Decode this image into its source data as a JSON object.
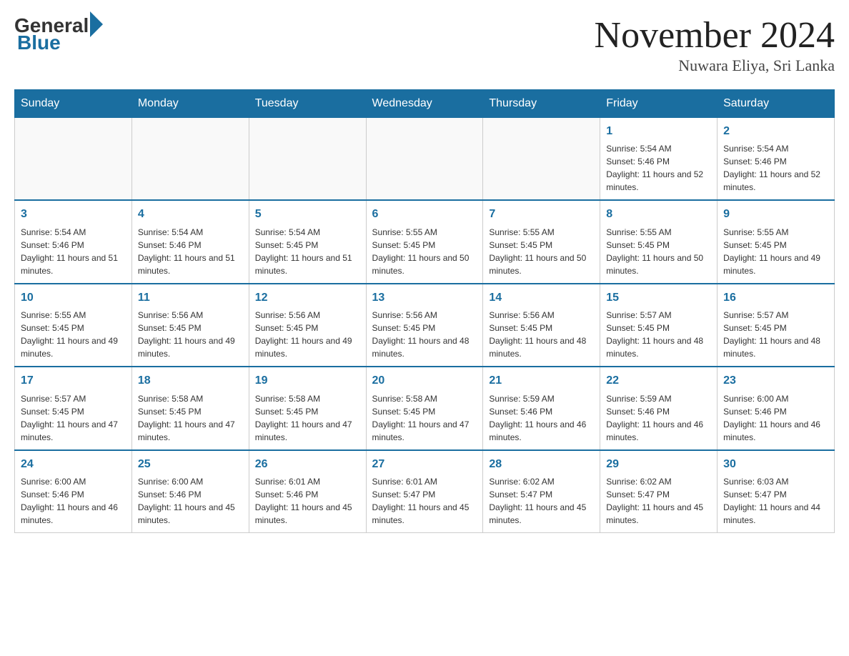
{
  "header": {
    "logo_general": "General",
    "logo_blue": "Blue",
    "month_year": "November 2024",
    "location": "Nuwara Eliya, Sri Lanka"
  },
  "days_of_week": [
    "Sunday",
    "Monday",
    "Tuesday",
    "Wednesday",
    "Thursday",
    "Friday",
    "Saturday"
  ],
  "weeks": [
    {
      "days": [
        {
          "number": "",
          "info": ""
        },
        {
          "number": "",
          "info": ""
        },
        {
          "number": "",
          "info": ""
        },
        {
          "number": "",
          "info": ""
        },
        {
          "number": "",
          "info": ""
        },
        {
          "number": "1",
          "info": "Sunrise: 5:54 AM\nSunset: 5:46 PM\nDaylight: 11 hours and 52 minutes."
        },
        {
          "number": "2",
          "info": "Sunrise: 5:54 AM\nSunset: 5:46 PM\nDaylight: 11 hours and 52 minutes."
        }
      ]
    },
    {
      "days": [
        {
          "number": "3",
          "info": "Sunrise: 5:54 AM\nSunset: 5:46 PM\nDaylight: 11 hours and 51 minutes."
        },
        {
          "number": "4",
          "info": "Sunrise: 5:54 AM\nSunset: 5:46 PM\nDaylight: 11 hours and 51 minutes."
        },
        {
          "number": "5",
          "info": "Sunrise: 5:54 AM\nSunset: 5:45 PM\nDaylight: 11 hours and 51 minutes."
        },
        {
          "number": "6",
          "info": "Sunrise: 5:55 AM\nSunset: 5:45 PM\nDaylight: 11 hours and 50 minutes."
        },
        {
          "number": "7",
          "info": "Sunrise: 5:55 AM\nSunset: 5:45 PM\nDaylight: 11 hours and 50 minutes."
        },
        {
          "number": "8",
          "info": "Sunrise: 5:55 AM\nSunset: 5:45 PM\nDaylight: 11 hours and 50 minutes."
        },
        {
          "number": "9",
          "info": "Sunrise: 5:55 AM\nSunset: 5:45 PM\nDaylight: 11 hours and 49 minutes."
        }
      ]
    },
    {
      "days": [
        {
          "number": "10",
          "info": "Sunrise: 5:55 AM\nSunset: 5:45 PM\nDaylight: 11 hours and 49 minutes."
        },
        {
          "number": "11",
          "info": "Sunrise: 5:56 AM\nSunset: 5:45 PM\nDaylight: 11 hours and 49 minutes."
        },
        {
          "number": "12",
          "info": "Sunrise: 5:56 AM\nSunset: 5:45 PM\nDaylight: 11 hours and 49 minutes."
        },
        {
          "number": "13",
          "info": "Sunrise: 5:56 AM\nSunset: 5:45 PM\nDaylight: 11 hours and 48 minutes."
        },
        {
          "number": "14",
          "info": "Sunrise: 5:56 AM\nSunset: 5:45 PM\nDaylight: 11 hours and 48 minutes."
        },
        {
          "number": "15",
          "info": "Sunrise: 5:57 AM\nSunset: 5:45 PM\nDaylight: 11 hours and 48 minutes."
        },
        {
          "number": "16",
          "info": "Sunrise: 5:57 AM\nSunset: 5:45 PM\nDaylight: 11 hours and 48 minutes."
        }
      ]
    },
    {
      "days": [
        {
          "number": "17",
          "info": "Sunrise: 5:57 AM\nSunset: 5:45 PM\nDaylight: 11 hours and 47 minutes."
        },
        {
          "number": "18",
          "info": "Sunrise: 5:58 AM\nSunset: 5:45 PM\nDaylight: 11 hours and 47 minutes."
        },
        {
          "number": "19",
          "info": "Sunrise: 5:58 AM\nSunset: 5:45 PM\nDaylight: 11 hours and 47 minutes."
        },
        {
          "number": "20",
          "info": "Sunrise: 5:58 AM\nSunset: 5:45 PM\nDaylight: 11 hours and 47 minutes."
        },
        {
          "number": "21",
          "info": "Sunrise: 5:59 AM\nSunset: 5:46 PM\nDaylight: 11 hours and 46 minutes."
        },
        {
          "number": "22",
          "info": "Sunrise: 5:59 AM\nSunset: 5:46 PM\nDaylight: 11 hours and 46 minutes."
        },
        {
          "number": "23",
          "info": "Sunrise: 6:00 AM\nSunset: 5:46 PM\nDaylight: 11 hours and 46 minutes."
        }
      ]
    },
    {
      "days": [
        {
          "number": "24",
          "info": "Sunrise: 6:00 AM\nSunset: 5:46 PM\nDaylight: 11 hours and 46 minutes."
        },
        {
          "number": "25",
          "info": "Sunrise: 6:00 AM\nSunset: 5:46 PM\nDaylight: 11 hours and 45 minutes."
        },
        {
          "number": "26",
          "info": "Sunrise: 6:01 AM\nSunset: 5:46 PM\nDaylight: 11 hours and 45 minutes."
        },
        {
          "number": "27",
          "info": "Sunrise: 6:01 AM\nSunset: 5:47 PM\nDaylight: 11 hours and 45 minutes."
        },
        {
          "number": "28",
          "info": "Sunrise: 6:02 AM\nSunset: 5:47 PM\nDaylight: 11 hours and 45 minutes."
        },
        {
          "number": "29",
          "info": "Sunrise: 6:02 AM\nSunset: 5:47 PM\nDaylight: 11 hours and 45 minutes."
        },
        {
          "number": "30",
          "info": "Sunrise: 6:03 AM\nSunset: 5:47 PM\nDaylight: 11 hours and 44 minutes."
        }
      ]
    }
  ]
}
